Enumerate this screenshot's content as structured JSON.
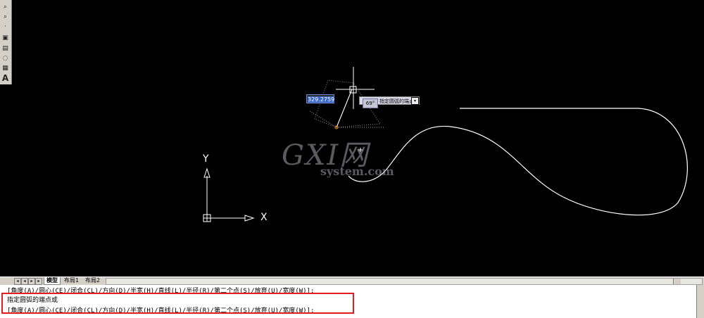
{
  "toolbar": {
    "items": [
      "zoom-window",
      "zoom-previous",
      "dot",
      "block",
      "insert",
      "hatch",
      "region",
      "table",
      "text"
    ]
  },
  "drawing": {
    "dynamic_input_value": "329.2759",
    "prompt_text": "指定圆弧的端点或",
    "angle_value": "69°",
    "axis_x_label": "X",
    "axis_y_label": "Y"
  },
  "watermark": {
    "logo": "GXI网",
    "site": "system.com"
  },
  "layout_tabs": {
    "model": "模型",
    "layout1": "布局1",
    "layout2": "布局2"
  },
  "command": {
    "history_line": "[角度(A)/圆心(CE)/闭合(CL)/方向(D)/半宽(H)/直线(L)/半径(R)/第二个点(S)/放弃(U)/宽度(W)]:",
    "prompt_line": "指定圆弧的端点或",
    "options_line": "[角度(A)/圆心(CE)/闭合(CL)/方向(D)/半宽(H)/直线(L)/半径(R)/第二个点(S)/放弃(U)/宽度(W)]:"
  },
  "colors": {
    "canvas": "#000000",
    "highlight_border": "#e02020",
    "geometry": "#ffffff",
    "snap_marker": "#ff8c00"
  }
}
